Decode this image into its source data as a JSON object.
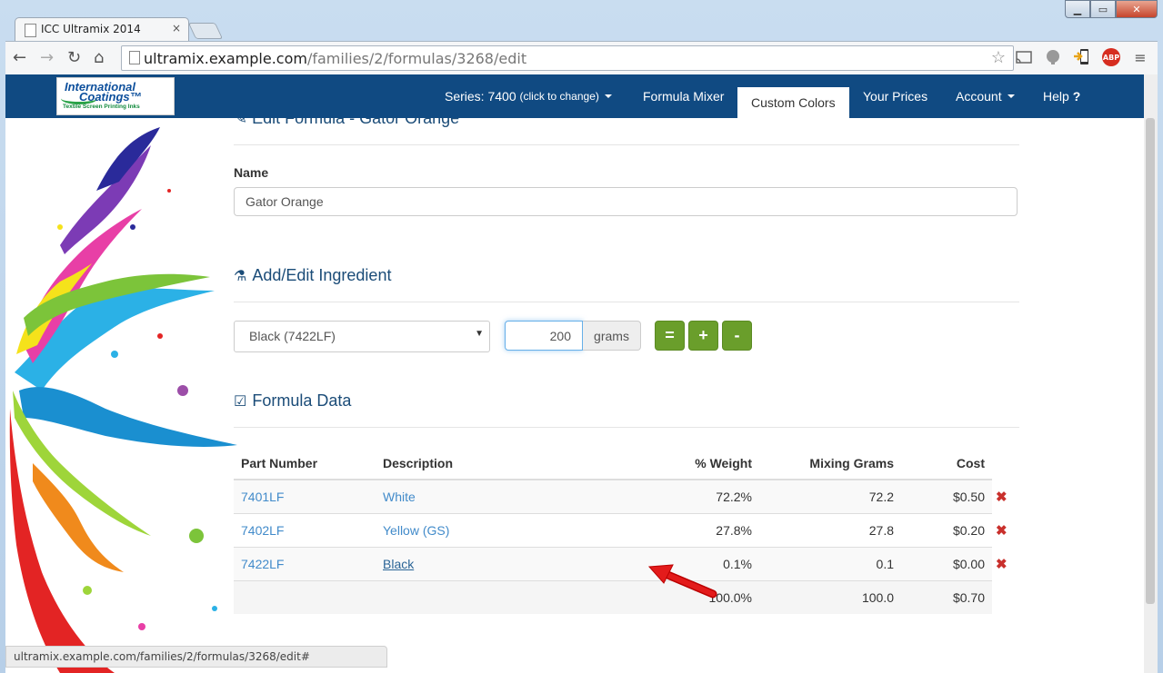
{
  "browser": {
    "tab_title": "ICC Ultramix 2014",
    "tab_close": "×",
    "url_domain": "ultramix.example.com",
    "url_path": "/families/2/formulas/3268/edit",
    "status_url": "ultramix.example.com/families/2/formulas/3268/edit#",
    "ext_abp": "ABP"
  },
  "logo": {
    "line1": "International",
    "line2": "Coatings™",
    "line3": "Textile Screen Printing Inks"
  },
  "navbar": {
    "series_label": "Series: 7400",
    "series_hint": "(click to change)",
    "formula_mixer": "Formula Mixer",
    "custom_colors": "Custom Colors",
    "your_prices": "Your Prices",
    "account": "Account",
    "help": "Help",
    "help_icon": "?"
  },
  "form": {
    "heading_partial": "Edit Formula - Gator Orange",
    "name_label": "Name",
    "name_value": "Gator Orange"
  },
  "ingredient": {
    "heading": "Add/Edit Ingredient",
    "selected": "Black (7422LF)",
    "quantity": "200",
    "unit": "grams",
    "btn_equals": "=",
    "btn_plus": "+",
    "btn_minus": "-"
  },
  "formula_data": {
    "heading": "Formula Data",
    "columns": [
      "Part Number",
      "Description",
      "% Weight",
      "Mixing Grams",
      "Cost"
    ],
    "rows": [
      {
        "part": "7401LF",
        "desc": "White",
        "weight": "72.2%",
        "grams": "72.2",
        "cost": "$0.50"
      },
      {
        "part": "7402LF",
        "desc": "Yellow (GS)",
        "weight": "27.8%",
        "grams": "27.8",
        "cost": "$0.20"
      },
      {
        "part": "7422LF",
        "desc": "Black",
        "weight": "0.1%",
        "grams": "0.1",
        "cost": "$0.00"
      }
    ],
    "total": {
      "weight": "100.0%",
      "grams": "100.0",
      "cost": "$0.70"
    },
    "delete_glyph": "✖"
  },
  "colors": {
    "navbar": "#104a82",
    "accent_green": "#6a9e2b",
    "link": "#428bca",
    "delete_red": "#c9302c"
  }
}
